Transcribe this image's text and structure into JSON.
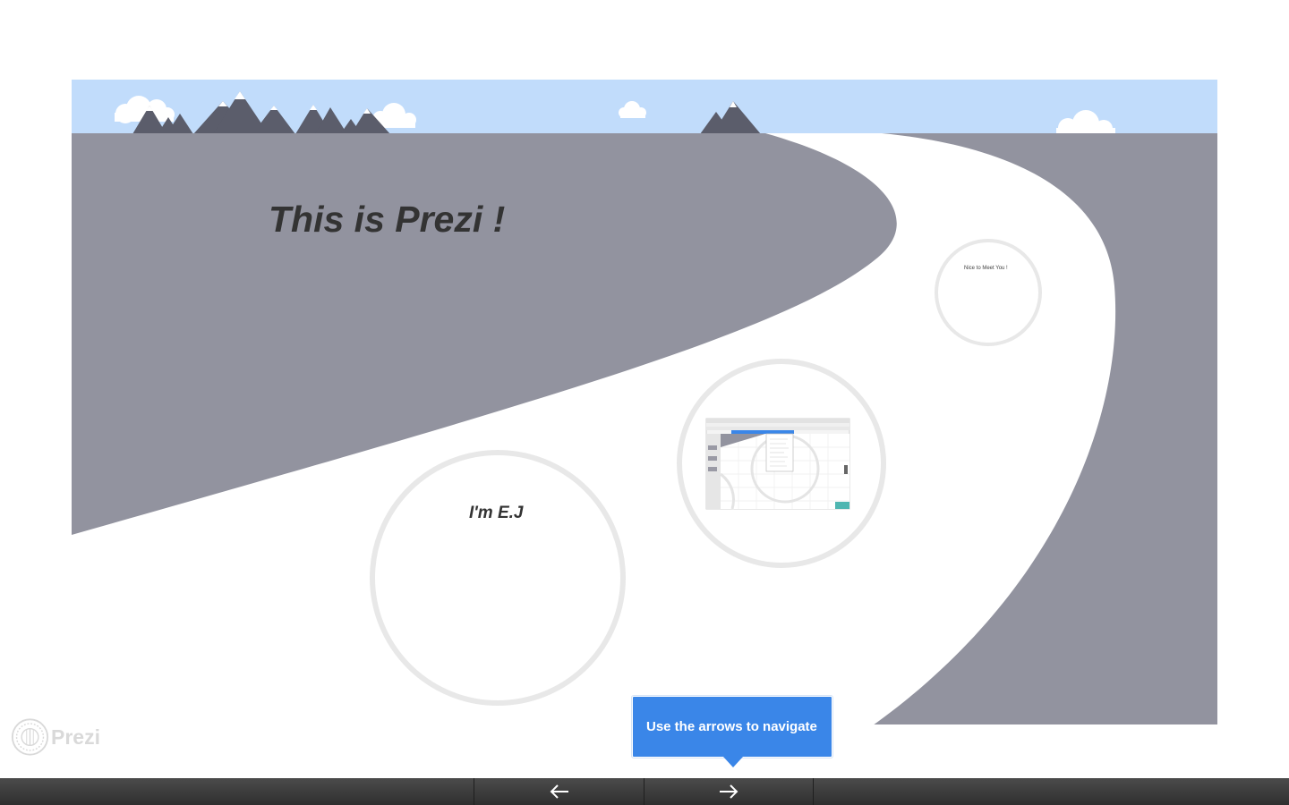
{
  "slide": {
    "title": "This is Prezi !"
  },
  "bubbles": {
    "intro_label": "I'm E.J",
    "nice_label": "Nice to Meet You !"
  },
  "brand": {
    "logo_text": "Prezi"
  },
  "tooltip": {
    "text": "Use the arrows to navigate"
  },
  "navigation": {
    "previous_icon": "arrow-left-icon",
    "next_icon": "arrow-right-icon"
  },
  "colors": {
    "sky": "#c1dcfb",
    "ground": "#92939f",
    "road": "#ffffff",
    "mountain": "#5b5d6b",
    "bubble_ring": "#e8e8e8",
    "accent": "#3a86e8",
    "navbar": "#3a3a3a"
  }
}
